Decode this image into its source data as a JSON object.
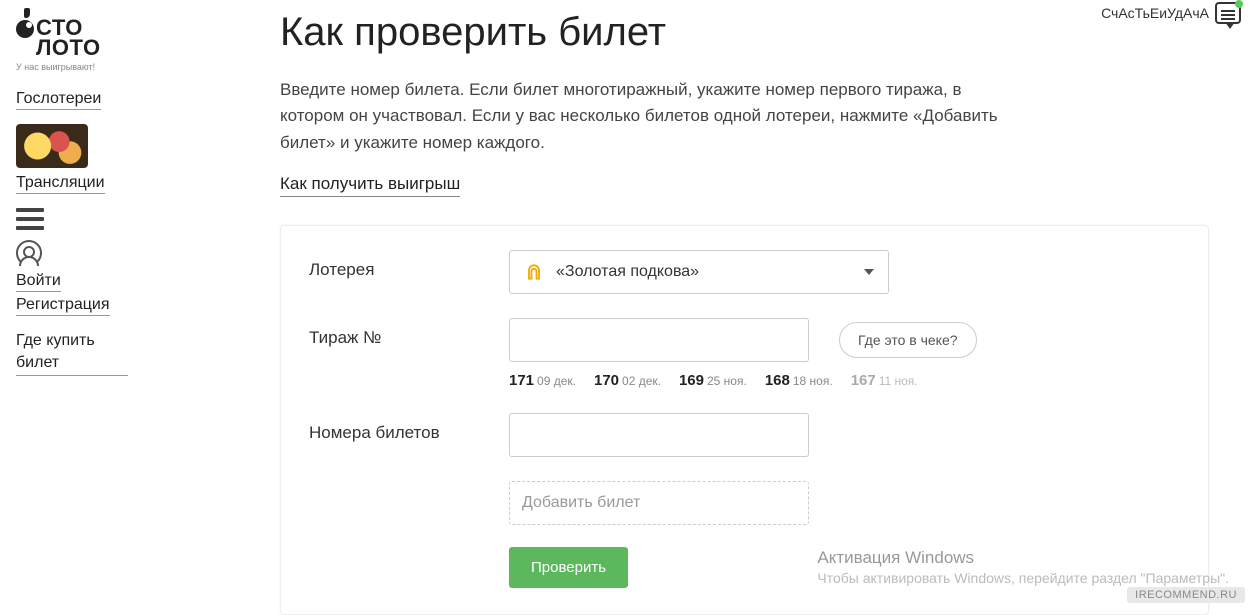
{
  "logo": {
    "line1": "СТО",
    "line2": "ЛОТО",
    "tagline": "У нас выигрывают!"
  },
  "sidebar": {
    "items": [
      {
        "label": "Гослотереи"
      },
      {
        "label": "Трансляции"
      },
      {
        "label": "Войти"
      },
      {
        "label": "Регистрация"
      },
      {
        "label": "Где купить билет"
      }
    ]
  },
  "page": {
    "title": "Как проверить билет",
    "intro": "Введите номер билета. Если билет многотиражный, укажите номер первого тиража, в котором он участвовал. Если у вас несколько билетов одной лотереи, нажмите «Добавить билет» и укажите номер каждого.",
    "winnings_link": "Как получить выигрыш"
  },
  "form": {
    "lottery_label": "Лотерея",
    "lottery_value": "«Золотая подкова»",
    "draw_label": "Тираж №",
    "draw_value": "",
    "hint_label": "Где это в чеке?",
    "tickets_label": "Номера билетов",
    "tickets_value": "",
    "add_ticket_label": "Добавить билет",
    "submit_label": "Проверить",
    "recent_draws": [
      {
        "num": "171",
        "date": "09 дек."
      },
      {
        "num": "170",
        "date": "02 дек."
      },
      {
        "num": "169",
        "date": "25 ноя."
      },
      {
        "num": "168",
        "date": "18 ноя."
      },
      {
        "num": "167",
        "date": "11 ноя.",
        "faded": true
      }
    ]
  },
  "overlay": {
    "username": "СчАсТьЕиУдАчА",
    "activation_title": "Активация Windows",
    "activation_body": "Чтобы активировать Windows, перейдите раздел \"Параметры\".",
    "site": "IRECOMMEND.RU"
  }
}
